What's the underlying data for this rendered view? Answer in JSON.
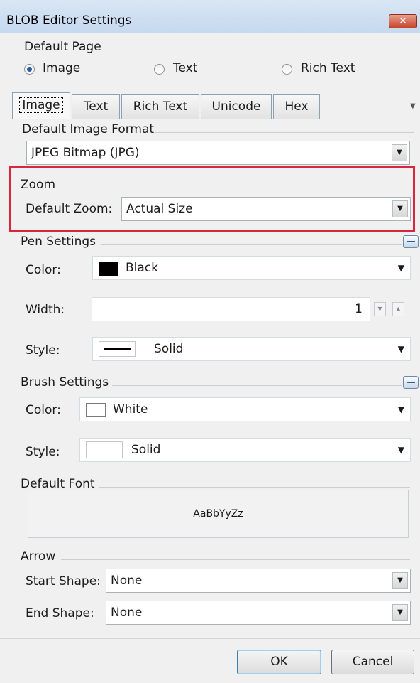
{
  "window": {
    "title": "BLOB Editor Settings",
    "close_glyph": "✕"
  },
  "default_page": {
    "label": "Default Page",
    "options": [
      {
        "label": "Image",
        "selected": true
      },
      {
        "label": "Text",
        "selected": false
      },
      {
        "label": "Rich Text",
        "selected": false
      }
    ]
  },
  "tabs": [
    {
      "label": "Image",
      "active": true
    },
    {
      "label": "Text",
      "active": false
    },
    {
      "label": "Rich Text",
      "active": false
    },
    {
      "label": "Unicode",
      "active": false
    },
    {
      "label": "Hex",
      "active": false
    }
  ],
  "image_format": {
    "label": "Default Image Format",
    "value": "JPEG Bitmap (JPG)"
  },
  "zoom": {
    "label": "Zoom",
    "field_label": "Default Zoom:",
    "value": "Actual Size"
  },
  "pen": {
    "label": "Pen Settings",
    "color_label": "Color:",
    "color_value": "Black",
    "color_hex": "#000000",
    "width_label": "Width:",
    "width_value": "1",
    "style_label": "Style:",
    "style_value": "Solid"
  },
  "brush": {
    "label": "Brush Settings",
    "color_label": "Color:",
    "color_value": "White",
    "color_hex": "#ffffff",
    "style_label": "Style:",
    "style_value": "Solid"
  },
  "font": {
    "label": "Default Font",
    "preview": "AaBbYyZz"
  },
  "arrow": {
    "label": "Arrow",
    "start_label": "Start Shape:",
    "start_value": "None",
    "end_label": "End Shape:",
    "end_value": "None"
  },
  "buttons": {
    "ok": "OK",
    "cancel": "Cancel"
  },
  "colors": {
    "highlight": "#d7263d",
    "title_bar": "#c6d9ee",
    "close_button": "#c8442d"
  }
}
